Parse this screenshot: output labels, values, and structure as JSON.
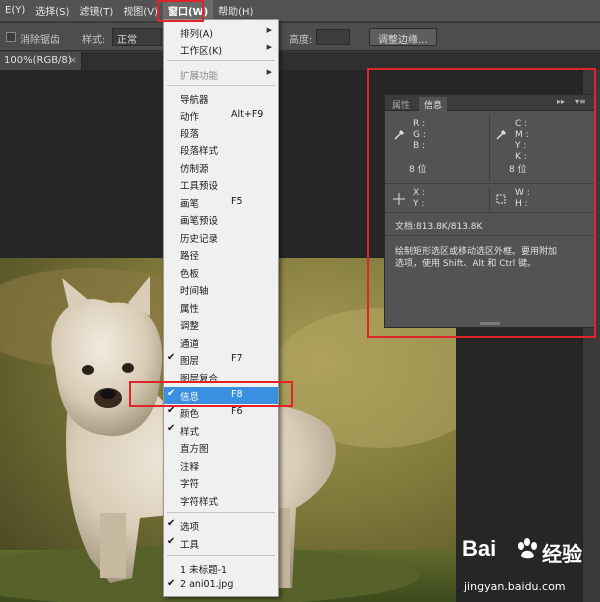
{
  "menubar": {
    "items": [
      "E(Y)",
      "选择(S)",
      "滤镜(T)",
      "视图(V)",
      "窗口(W)",
      "帮助(H)"
    ],
    "active": "窗口(W)"
  },
  "options": {
    "antialias_label": "消除锯齿",
    "style_label": "样式:",
    "style_value": "正常",
    "height_label": "高度:",
    "refine_button": "调整边缘..."
  },
  "document": {
    "tab_label": "100%(RGB/8)",
    "close_glyph": "×"
  },
  "window_menu": {
    "items": [
      {
        "label": "排列(A)",
        "submenu": true
      },
      {
        "label": "工作区(K)",
        "submenu": true
      },
      {
        "separator": true
      },
      {
        "label": "扩展功能",
        "submenu": true,
        "disabled": true
      },
      {
        "separator": true
      },
      {
        "label": "导航器"
      },
      {
        "label": "动作",
        "shortcut": "Alt+F9"
      },
      {
        "label": "段落"
      },
      {
        "label": "段落样式"
      },
      {
        "label": "仿制源"
      },
      {
        "label": "工具预设"
      },
      {
        "label": "画笔",
        "shortcut": "F5"
      },
      {
        "label": "画笔预设"
      },
      {
        "label": "历史记录"
      },
      {
        "label": "路径"
      },
      {
        "label": "色板"
      },
      {
        "label": "时间轴"
      },
      {
        "label": "属性"
      },
      {
        "label": "调整"
      },
      {
        "label": "通道"
      },
      {
        "label": "图层",
        "shortcut": "F7",
        "checked": true
      },
      {
        "label": "图层复合"
      },
      {
        "label": "信息",
        "shortcut": "F8",
        "checked": true,
        "highlighted": true
      },
      {
        "label": "颜色",
        "shortcut": "F6",
        "checked": true
      },
      {
        "label": "样式",
        "checked": true
      },
      {
        "label": "直方图"
      },
      {
        "label": "注释"
      },
      {
        "label": "字符"
      },
      {
        "label": "字符样式"
      },
      {
        "separator": true
      },
      {
        "label": "选项",
        "checked": true
      },
      {
        "label": "工具",
        "checked": true
      },
      {
        "separator": true
      },
      {
        "label": "1 未标题-1"
      },
      {
        "label": "2 ani01.jpg",
        "checked": true
      }
    ]
  },
  "info_panel": {
    "tabs": [
      "属性",
      "信息"
    ],
    "active_tab": "信息",
    "collapse_glyph": "▸▸",
    "menu_glyph": "▾≡",
    "rgb_labels": [
      "R :",
      "G :",
      "B :"
    ],
    "rgb_bits": "8 位",
    "cmyk_labels": [
      "C :",
      "M :",
      "Y :",
      "K :"
    ],
    "cmyk_bits": "8 位",
    "xy_labels": [
      "X :",
      "Y :"
    ],
    "wh_labels": [
      "W :",
      "H :"
    ],
    "doc_size": "文档:813.8K/813.8K",
    "hint_line1": "绘制矩形选区或移动选区外框。要用附加",
    "hint_line2": "选项，使用 Shift、Alt 和 Ctrl 键。"
  },
  "watermark": {
    "brand": "Bai",
    "brand_suffix": "经验",
    "url": "jingyan.baidu.com"
  }
}
